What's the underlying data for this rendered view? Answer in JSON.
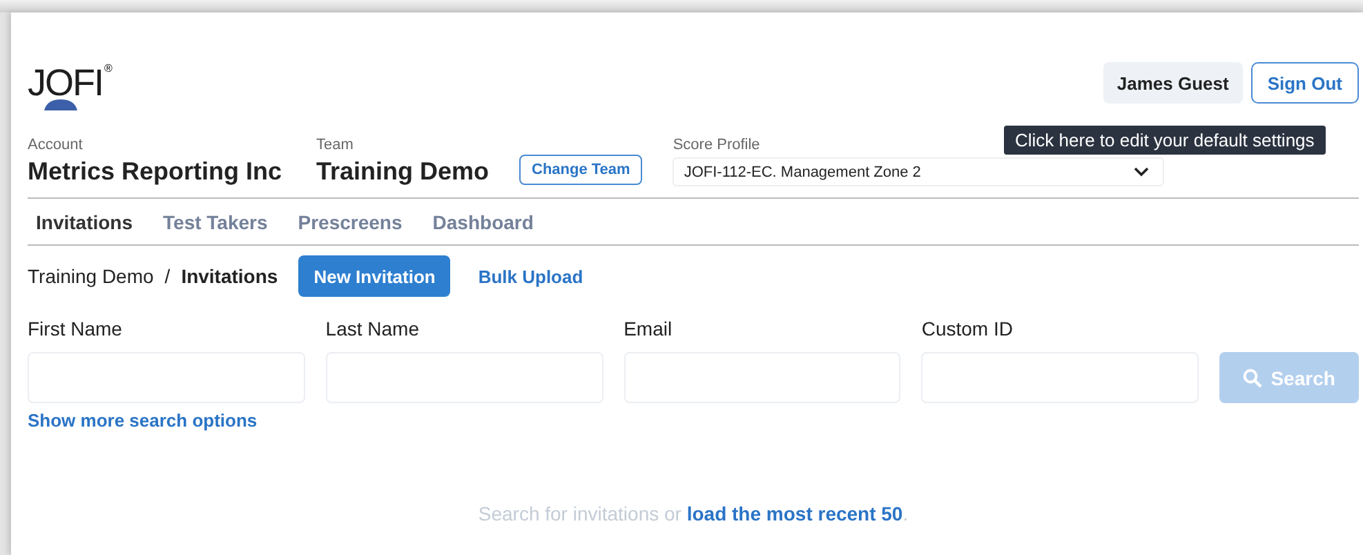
{
  "logo": {
    "text": "JOFI",
    "mark": "®"
  },
  "user": {
    "name": "James Guest",
    "sign_out": "Sign Out"
  },
  "tooltip": "Click here to edit your default settings",
  "account": {
    "label": "Account",
    "value": "Metrics Reporting Inc"
  },
  "team": {
    "label": "Team",
    "value": "Training Demo",
    "button": "Change Team"
  },
  "score_profile": {
    "label": "Score Profile",
    "value": "JOFI-112-EC. Management Zone 2"
  },
  "tabs": [
    {
      "label": "Invitations",
      "selected": true
    },
    {
      "label": "Test Takers",
      "selected": false
    },
    {
      "label": "Prescreens",
      "selected": false
    },
    {
      "label": "Dashboard",
      "selected": false
    }
  ],
  "breadcrumb": {
    "parent": "Training Demo",
    "separator": "/",
    "current": "Invitations"
  },
  "actions": {
    "new": "New Invitation",
    "bulk": "Bulk Upload"
  },
  "fields": [
    {
      "label": "First Name"
    },
    {
      "label": "Last Name"
    },
    {
      "label": "Email"
    },
    {
      "label": "Custom ID"
    }
  ],
  "search_button": {
    "label": "Search",
    "disabled": true
  },
  "more_options": "Show more search options",
  "empty": {
    "text": "Search for invitations or",
    "link": "load the most recent 50",
    "end": "."
  }
}
